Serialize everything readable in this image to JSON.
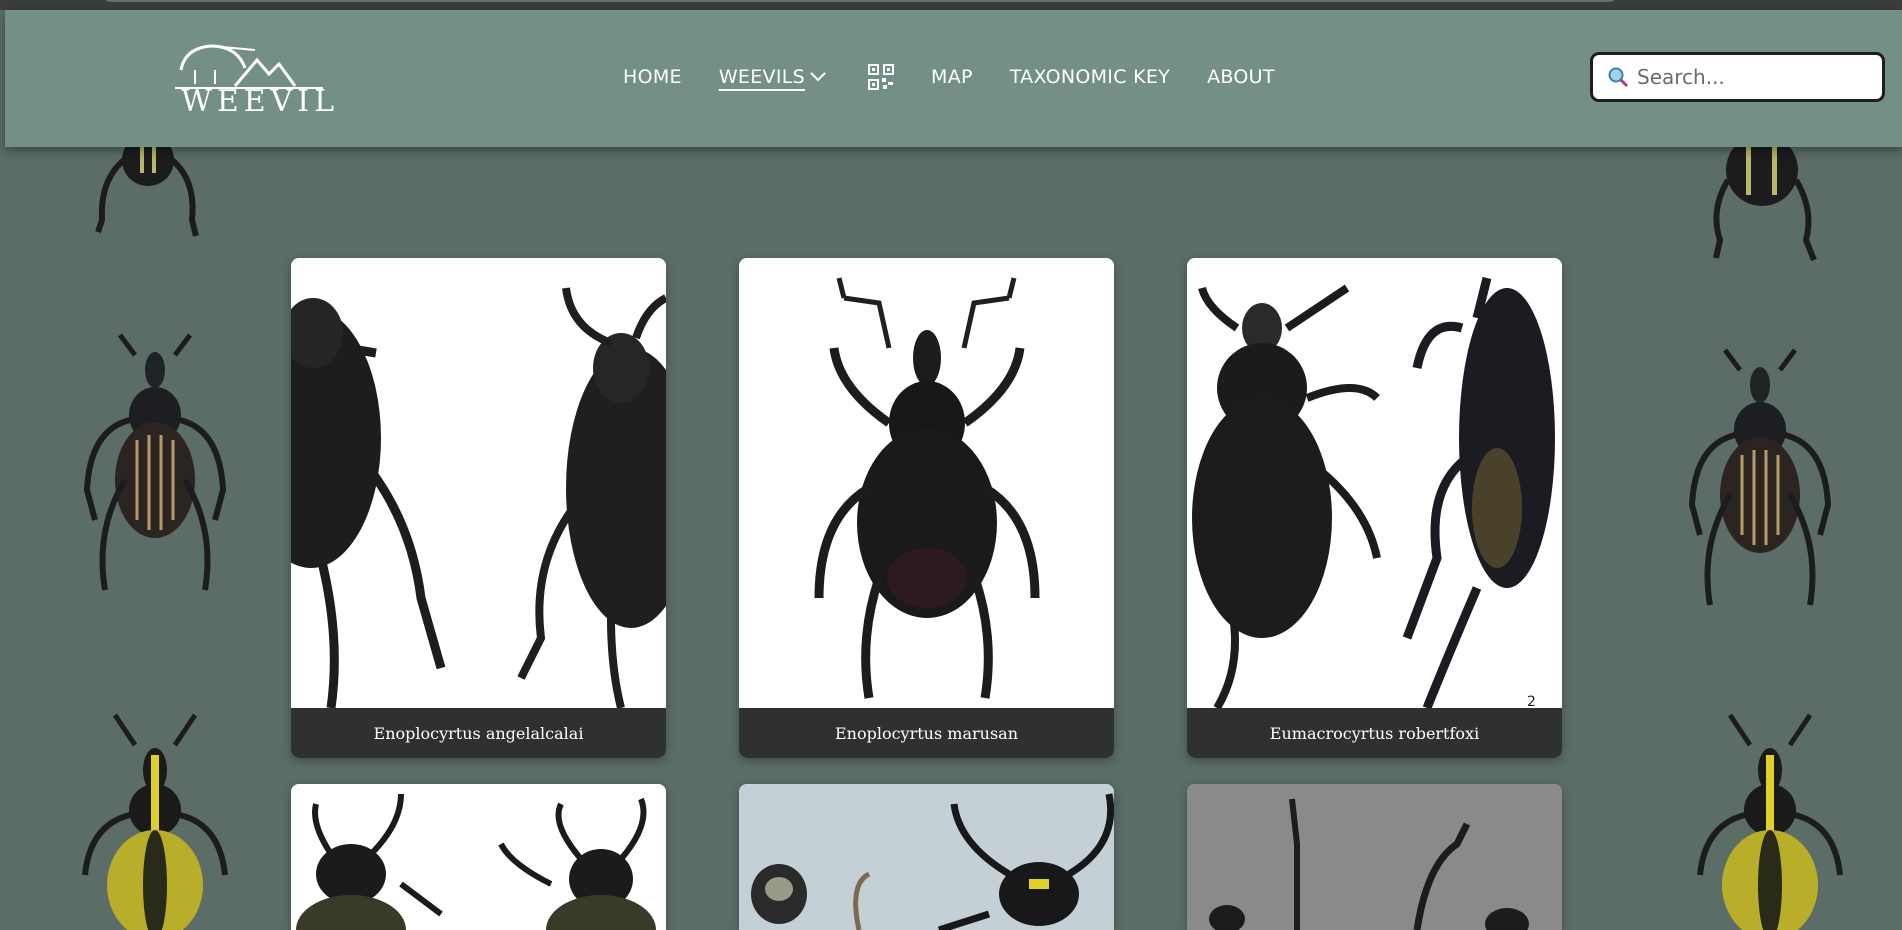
{
  "header": {
    "logo_text": "WEEVIL",
    "nav": [
      {
        "label": "HOME"
      },
      {
        "label": "WEEVILS"
      },
      {
        "label": "MAP"
      },
      {
        "label": "TAXONOMIC KEY"
      },
      {
        "label": "ABOUT"
      }
    ],
    "search_placeholder": "Search..."
  },
  "cards": [
    {
      "name": "Enoplocyrtus angelalcalai"
    },
    {
      "name": "Enoplocyrtus marusan"
    },
    {
      "name": "Eumacrocyrtus robertfoxi"
    },
    {
      "name": ""
    },
    {
      "name": ""
    },
    {
      "name": ""
    }
  ],
  "colors": {
    "page_bg": "#5c6d68",
    "header_bg": "#738f88",
    "caption_bg": "#2e3130"
  }
}
